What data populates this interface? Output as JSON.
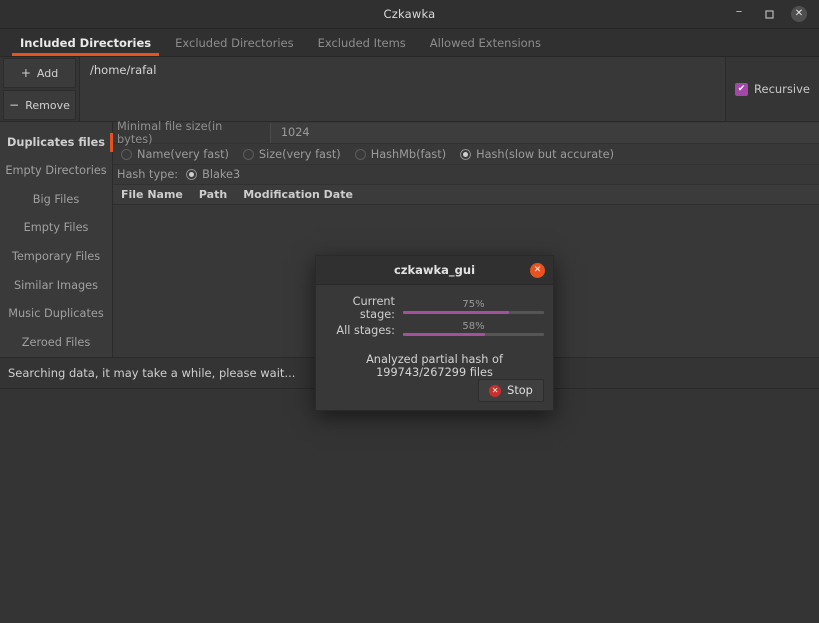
{
  "window": {
    "title": "Czkawka",
    "minimize_label": "–",
    "maximize_label": "□",
    "close_label": "✕"
  },
  "tabs": [
    {
      "label": "Included Directories",
      "active": true
    },
    {
      "label": "Excluded Directories",
      "active": false
    },
    {
      "label": "Excluded Items",
      "active": false
    },
    {
      "label": "Allowed Extensions",
      "active": false
    }
  ],
  "directories": {
    "add_label": "Add",
    "add_sign": "+",
    "remove_label": "Remove",
    "remove_sign": "−",
    "paths": [
      "/home/rafal"
    ],
    "recursive_label": "Recursive",
    "recursive_checked": true,
    "check_glyph": "✔"
  },
  "sidebar": {
    "items": [
      {
        "label": "Duplicates files",
        "active": true
      },
      {
        "label": "Empty Directories",
        "active": false
      },
      {
        "label": "Big Files",
        "active": false
      },
      {
        "label": "Empty Files",
        "active": false
      },
      {
        "label": "Temporary Files",
        "active": false
      },
      {
        "label": "Similar Images",
        "active": false
      },
      {
        "label": "Music Duplicates",
        "active": false
      },
      {
        "label": "Zeroed Files",
        "active": false
      }
    ]
  },
  "settings": {
    "min_size_label": "Minimal file size(in bytes)",
    "min_size_value": "1024",
    "check_methods": [
      {
        "label": "Name(very fast)",
        "selected": false
      },
      {
        "label": "Size(very fast)",
        "selected": false
      },
      {
        "label": "HashMb(fast)",
        "selected": false
      },
      {
        "label": "Hash(slow but accurate)",
        "selected": true
      }
    ],
    "hash_type_label": "Hash type:",
    "hash_types": [
      {
        "label": "Blake3",
        "selected": true
      }
    ]
  },
  "table": {
    "columns": [
      "File Name",
      "Path",
      "Modification Date"
    ],
    "rows": []
  },
  "statusbar": {
    "message": "Searching data, it may take a while, please wait..."
  },
  "dialog": {
    "title": "czkawka_gui",
    "close_label": "✕",
    "progress": [
      {
        "label": "Current stage:",
        "percent_text": "75%",
        "percent": 75
      },
      {
        "label": "All stages:",
        "percent_text": "58%",
        "percent": 58
      }
    ],
    "message": "Analyzed partial hash of 199743/267299 files",
    "stop_label": "Stop",
    "stop_icon_glyph": "✕"
  },
  "colors": {
    "accent_orange": "#e8521f",
    "progress_purple": "#a3519d",
    "checkbox_purple": "#a347a8",
    "stop_red": "#c9302c",
    "window_bg": "#383838",
    "chrome_bg": "#303030"
  }
}
